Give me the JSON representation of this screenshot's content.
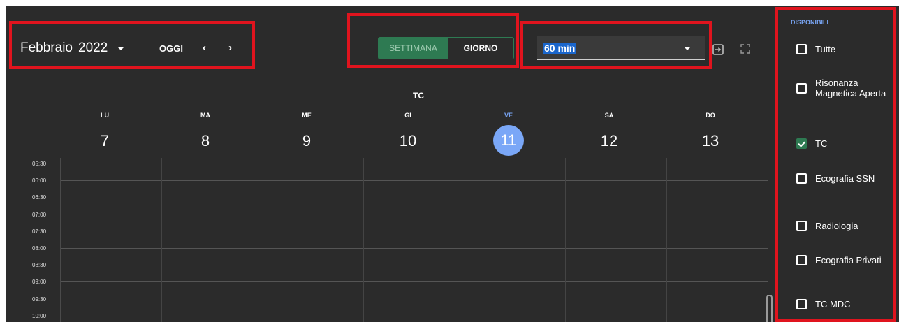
{
  "toolbar": {
    "month": "Febbraio",
    "year": "2022",
    "today_label": "OGGI",
    "prev_icon": "‹",
    "next_icon": "›",
    "view_week_label": "SETTIMANA",
    "view_day_label": "GIORNO",
    "interval_value": "60 min"
  },
  "calendar": {
    "title": "TC",
    "days": [
      {
        "name": "LU",
        "num": "7"
      },
      {
        "name": "MA",
        "num": "8"
      },
      {
        "name": "ME",
        "num": "9"
      },
      {
        "name": "GI",
        "num": "10"
      },
      {
        "name": "VE",
        "num": "11"
      },
      {
        "name": "SA",
        "num": "12"
      },
      {
        "name": "DO",
        "num": "13"
      }
    ],
    "times": [
      "05:30",
      "06:00",
      "06:30",
      "07:00",
      "07:30",
      "08:00",
      "08:30",
      "09:00",
      "09:30",
      "10:00"
    ]
  },
  "sidebar": {
    "title": "DISPONIBILI",
    "items": [
      {
        "label": "Tutte",
        "checked": false
      },
      {
        "label": "Risonanza Magnetica Aperta",
        "checked": false
      },
      {
        "label": "TC",
        "checked": true
      },
      {
        "label": "Ecografia SSN",
        "checked": false
      },
      {
        "label": "Radiologia",
        "checked": false
      },
      {
        "label": "Ecografia Privati",
        "checked": false
      },
      {
        "label": "TC MDC",
        "checked": false
      }
    ]
  },
  "colors": {
    "background": "#2b2b2b",
    "accent_green": "#2e7a52",
    "today_blue": "#7aa7f7",
    "highlight_red": "#e0141e"
  }
}
